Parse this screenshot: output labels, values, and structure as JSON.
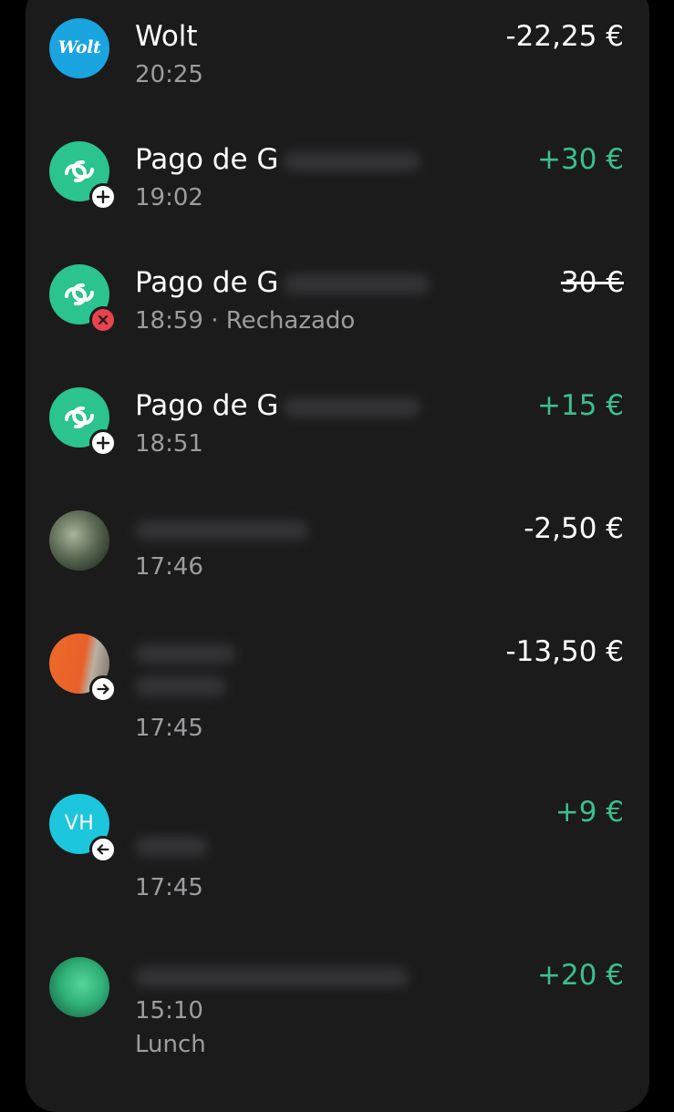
{
  "transactions": [
    {
      "title": "Wolt",
      "time": "20:25",
      "amount": "-22,25 €",
      "logo": "Wolt"
    },
    {
      "title": "Pago de G",
      "time": "19:02",
      "amount": "+30 €",
      "badge": "plus-icon"
    },
    {
      "title": "Pago de G",
      "time": "18:59",
      "status": "· Rechazado",
      "amount": "30 €",
      "badge": "close-icon"
    },
    {
      "title": "Pago de G",
      "time": "18:51",
      "amount": "+15 €",
      "badge": "plus-icon"
    },
    {
      "time": "17:46",
      "amount": "-2,50 €"
    },
    {
      "time": "17:45",
      "amount": "-13,50 €",
      "badge": "arrow-right-icon"
    },
    {
      "avatar_initials": "VH",
      "time": "17:45",
      "amount": "+9 €",
      "badge": "arrow-left-icon"
    },
    {
      "time": "15:10",
      "note": "Lunch",
      "amount": "+20 €"
    }
  ],
  "colors": {
    "background": "#000000",
    "card": "#1b1b1c",
    "positive": "#3dbf8c",
    "wolt": "#1aa4e0",
    "link_avatar": "#2bc38e",
    "rejected_badge": "#e8434e"
  }
}
